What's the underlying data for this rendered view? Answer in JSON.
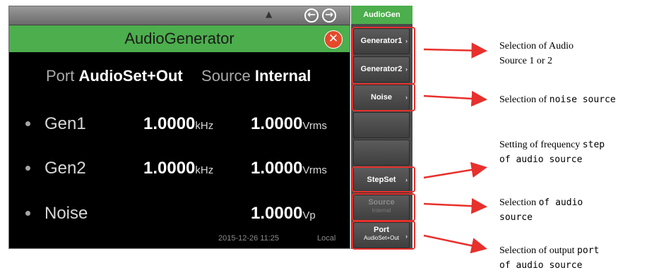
{
  "panel_title": "AudioGen",
  "screen": {
    "title": "AudioGenerator",
    "port_label": "Port",
    "port_value": "AudioSet+Out",
    "source_label": "Source",
    "source_value": "Internal",
    "rows": [
      {
        "name": "Gen1",
        "freq": "1.0000",
        "freq_unit": "kHz",
        "level": "1.0000",
        "level_unit": "Vrms"
      },
      {
        "name": "Gen2",
        "freq": "1.0000",
        "freq_unit": "kHz",
        "level": "1.0000",
        "level_unit": "Vrms"
      },
      {
        "name": "Noise",
        "freq": "",
        "freq_unit": "",
        "level": "1.0000",
        "level_unit": "Vp"
      }
    ],
    "status_time": "2015-12-26 11:25",
    "status_location": "Local"
  },
  "softkeys": {
    "generator1": "Generator1",
    "generator2": "Generator2",
    "noise": "Noise",
    "stepset": "StepSet",
    "source": "Source",
    "source_sub": "Internal",
    "port": "Port",
    "port_sub": "AudioSet+Out"
  },
  "annotations": {
    "a1_l1": "Selection of Audio",
    "a1_l2": "Source 1 or 2",
    "a2_p1": "Selection of ",
    "a2_p2": "noise source",
    "a3_p1": "Setting of frequency ",
    "a3_p2": "step",
    "a3_l2": "of audio source",
    "a4_p1": "Selection ",
    "a4_p2": "of audio",
    "a4_l2": "source",
    "a5_p1": "Selection of output ",
    "a5_p2": "port",
    "a5_l2": "of audio source"
  },
  "colors": {
    "accent_green": "#4cae4c",
    "highlight_red": "#e8302c",
    "close_red": "#e54a2a"
  },
  "icons": [
    "pin-icon",
    "back-arrow-icon",
    "forward-arrow-icon",
    "close-icon",
    "chevron-right-icon"
  ]
}
